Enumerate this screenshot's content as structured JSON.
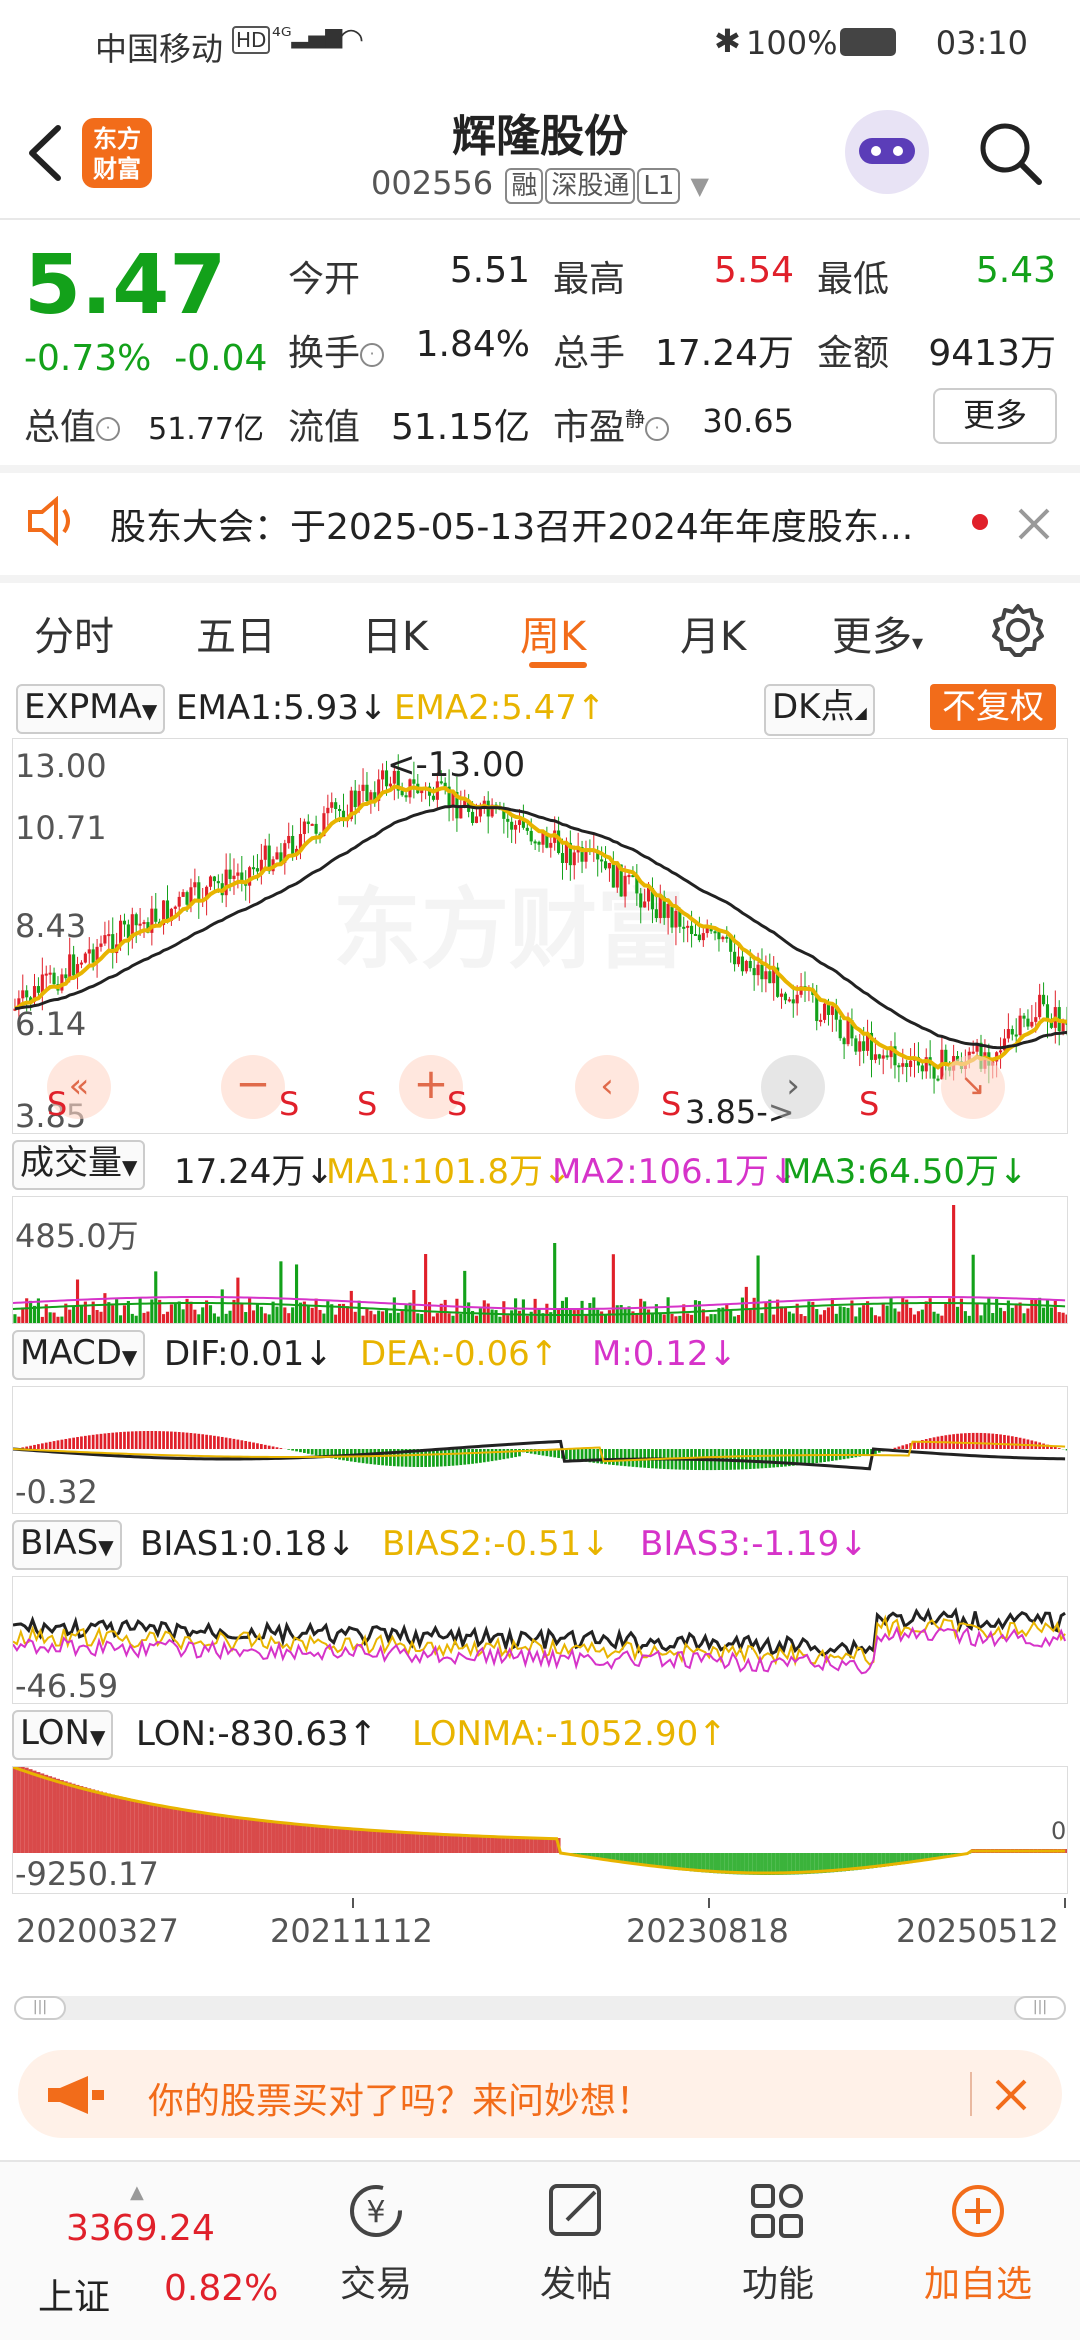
{
  "status_bar": {
    "carrier": "中国移动",
    "network": "HD 4G",
    "battery": "100%",
    "time": "03:10"
  },
  "header": {
    "back_icon": "back-arrow-icon",
    "logo_line1": "东方",
    "logo_line2": "财富",
    "title": "辉隆股份",
    "code": "002556",
    "tags": [
      "融",
      "深股通",
      "L1"
    ]
  },
  "quote": {
    "price": "5.47",
    "change_pct": "-0.73%",
    "change_amt": "-0.04",
    "open_label": "今开",
    "open": "5.51",
    "high_label": "最高",
    "high": "5.54",
    "low_label": "最低",
    "low": "5.43",
    "turnover_label": "换手",
    "turnover": "1.84%",
    "volume_label": "总手",
    "volume": "17.24万",
    "amount_label": "金额",
    "amount": "9413万",
    "mktcap_label": "总值",
    "mktcap": "51.77亿",
    "float_label": "流值",
    "float": "51.15亿",
    "pe_label": "市盈",
    "pe_sup": "静",
    "pe": "30.65",
    "more": "更多"
  },
  "notice": {
    "text": "股东大会：于2025-05-13召开2024年年度股东..."
  },
  "tabs": {
    "items": [
      "分时",
      "五日",
      "日K",
      "周K",
      "月K",
      "更多"
    ],
    "active": "周K"
  },
  "kline": {
    "indicator": "EXPMA",
    "ema1": "EMA1:5.93",
    "ema2": "EMA2:5.47",
    "dk": "DK点",
    "adjust": "不复权",
    "y_labels": [
      "13.00",
      "10.71",
      "8.43",
      "6.14",
      "3.85"
    ],
    "high_marker": "<-13.00",
    "low_marker": "3.85->",
    "sell_marker": "S"
  },
  "volume": {
    "label": "成交量",
    "value": "17.24万",
    "ma1": "MA1:101.8万",
    "ma2": "MA2:106.1万",
    "ma3": "MA3:64.50万",
    "y_top": "485.0万"
  },
  "macd": {
    "label": "MACD",
    "dif": "DIF:0.01",
    "dea": "DEA:-0.06",
    "m": "M:0.12",
    "y_bottom": "-0.32"
  },
  "bias": {
    "label": "BIAS",
    "b1": "BIAS1:0.18",
    "b2": "BIAS2:-0.51",
    "b3": "BIAS3:-1.19",
    "y_bottom": "-46.59"
  },
  "lon": {
    "label": "LON",
    "lon": "LON:-830.63",
    "lonma": "LONMA:-1052.90",
    "y_bottom": "-9250.17",
    "y_right": "0"
  },
  "x_axis": [
    "20200327",
    "20211112",
    "20230818",
    "20250512"
  ],
  "ad": {
    "text": "你的股票买对了吗？来问妙想！"
  },
  "bottom_nav": {
    "index_value": "3369.24",
    "index_name": "上证",
    "index_pct": "0.82%",
    "trade": "交易",
    "post": "发帖",
    "func": "功能",
    "add": "加自选"
  },
  "colors": {
    "up": "#e0202a",
    "down": "#13a11a",
    "accent": "#f26c1a",
    "ema2": "#e8b400",
    "pink": "#d633c9"
  }
}
